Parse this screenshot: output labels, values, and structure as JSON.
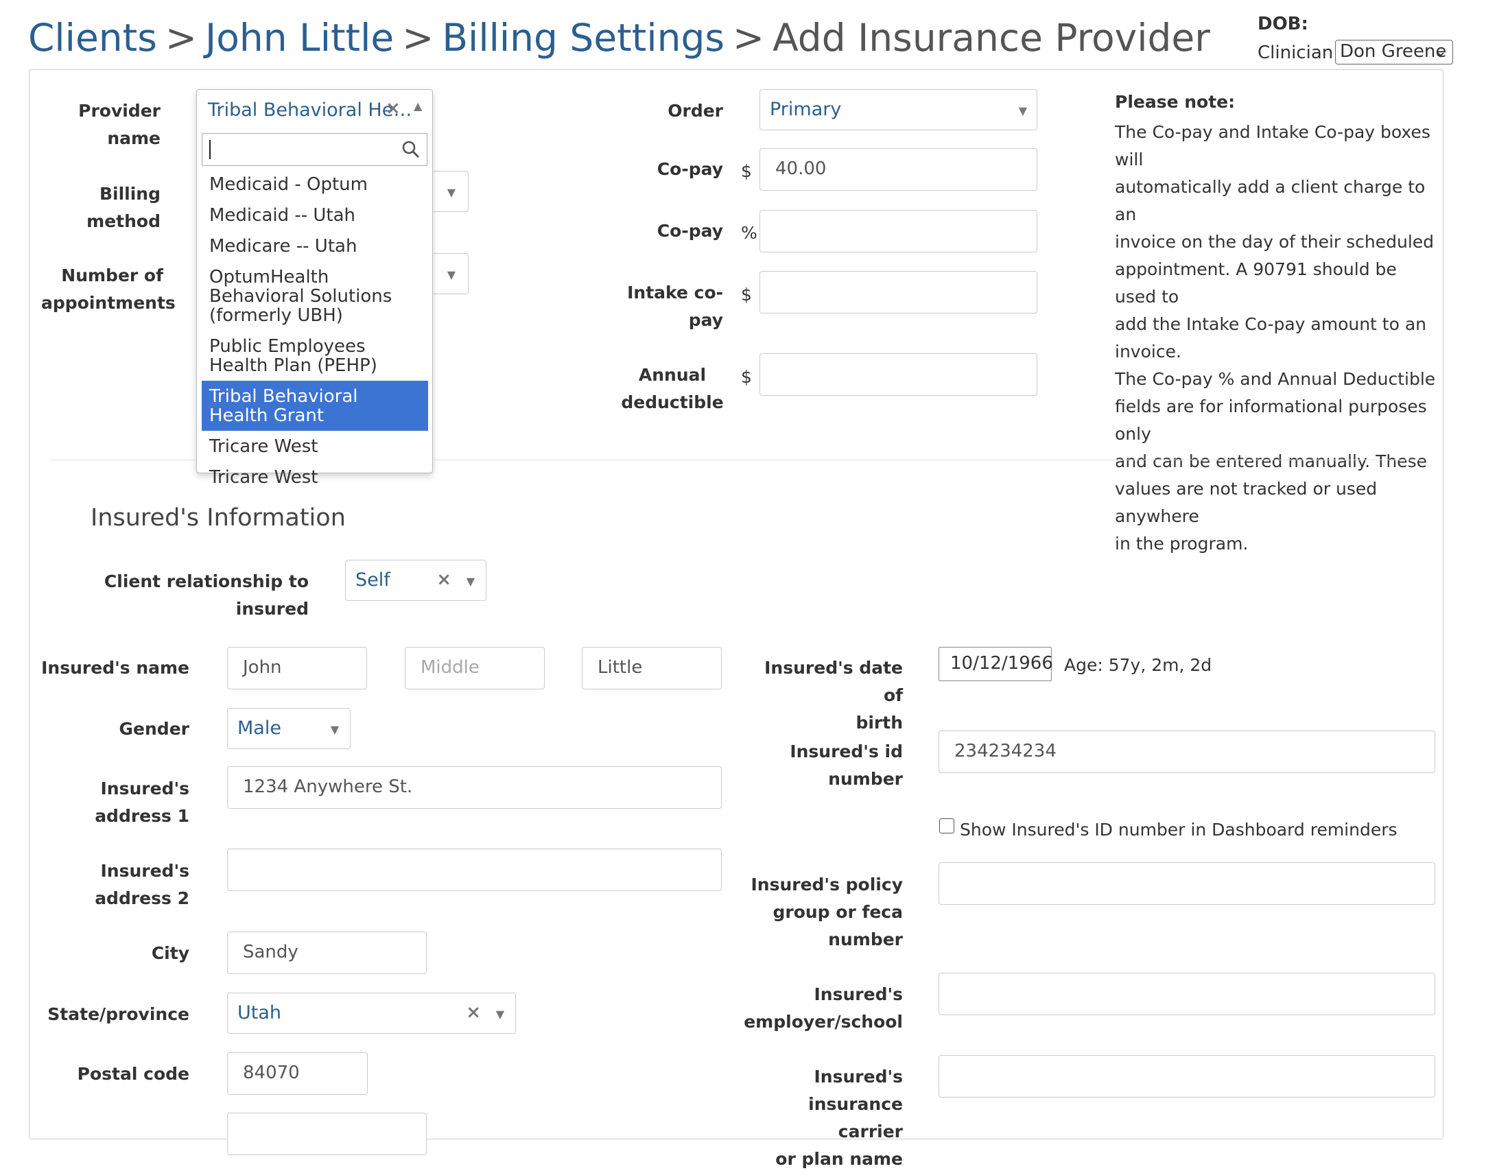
{
  "breadcrumb": {
    "clients": "Clients",
    "client_name": "John Little",
    "billing": "Billing Settings",
    "current": "Add Insurance Provider",
    "separator": ">"
  },
  "header": {
    "dob_label": "DOB:",
    "clinician_label": "Clinician:",
    "clinician_value": "Don Greene"
  },
  "provider": {
    "label_line1": "Provider",
    "label_line2": "name",
    "selected_display": "Tribal Behavioral He…",
    "search_value": "",
    "options": [
      "Medicaid - Optum",
      "Medicaid -- Utah",
      "Medicare -- Utah",
      "OptumHealth Behavioral Solutions (formerly UBH)",
      "Public Employees Health Plan (PEHP)",
      "Tribal Behavioral Health Grant",
      "Tricare West",
      "Tricare West"
    ],
    "selected_index": 5
  },
  "billing_method": {
    "label_line1": "Billing",
    "label_line2": "method"
  },
  "num_appointments": {
    "label_line1": "Number of",
    "label_line2": "appointments"
  },
  "order": {
    "label": "Order",
    "value": "Primary"
  },
  "copay": {
    "label": "Co-pay",
    "prefix": "$",
    "value": "40.00"
  },
  "copay_pct": {
    "label": "Co-pay",
    "prefix": "%",
    "value": ""
  },
  "intake_copay": {
    "label_line1": "Intake co-",
    "label_line2": "pay",
    "prefix": "$",
    "value": ""
  },
  "annual_deductible": {
    "label_line1": "Annual",
    "label_line2": "deductible",
    "prefix": "$",
    "value": ""
  },
  "note": {
    "title": "Please note:",
    "lines": [
      "The Co-pay and Intake Co-pay boxes will",
      "automatically add a client charge to an",
      "invoice on the day of their scheduled",
      "appointment. A 90791 should be used to",
      "add the Intake Co-pay amount to an",
      "invoice.",
      "The Co-pay % and Annual Deductible",
      "fields are for informational purposes only",
      "and can be entered manually. These",
      "values are not tracked or used anywhere",
      "in the program."
    ]
  },
  "insured": {
    "section_title": "Insured's Information",
    "relationship_label": "Client relationship to insured",
    "relationship_value": "Self",
    "name_label": "Insured's name",
    "first": "John",
    "middle_placeholder": "Middle",
    "last": "Little",
    "gender_label": "Gender",
    "gender_value": "Male",
    "address1_label_line1": "Insured's",
    "address1_label_line2": "address 1",
    "address1": "1234 Anywhere St.",
    "address2_label_line1": "Insured's",
    "address2_label_line2": "address 2",
    "address2": "",
    "city_label": "City",
    "city": "Sandy",
    "state_label": "State/province",
    "state": "Utah",
    "postal_label": "Postal code",
    "postal": "84070",
    "dob_label_line1": "Insured's date of",
    "dob_label_line2": "birth",
    "dob": "10/12/1966",
    "age": "Age: 57y, 2m, 2d",
    "id_label_line1": "Insured's id",
    "id_label_line2": "number",
    "id": "234234234",
    "show_id_label": "Show Insured's ID number in Dashboard reminders",
    "show_id_checked": false,
    "policy_label_line1": "Insured's policy",
    "policy_label_line2": "group or feca",
    "policy_label_line3": "number",
    "policy": "",
    "employer_label_line1": "Insured's",
    "employer_label_line2": "employer/school",
    "employer": "",
    "carrier_label_line1": "Insured's",
    "carrier_label_line2": "insurance carrier",
    "carrier_label_line3": "or plan name",
    "carrier": ""
  },
  "colors": {
    "link": "#2b5f8f",
    "selected_option_bg": "#3c74d3",
    "border": "#cccccc"
  }
}
